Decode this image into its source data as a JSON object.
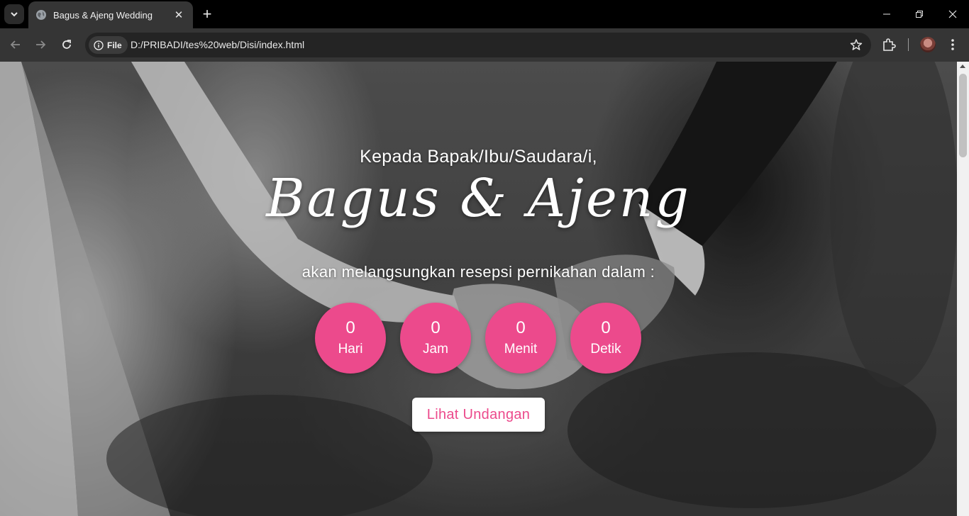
{
  "browser": {
    "tab_title": "Bagus & Ajeng Wedding",
    "url_chip": "File",
    "url": "D:/PRIBADI/tes%20web/Disi/index.html"
  },
  "page": {
    "greeting": "Kepada Bapak/Ibu/Saudara/i,",
    "couple": "Bagus & Ajeng",
    "subtitle": "akan melangsungkan resepsi pernikahan dalam :",
    "countdown": [
      {
        "value": "0",
        "label": "Hari"
      },
      {
        "value": "0",
        "label": "Jam"
      },
      {
        "value": "0",
        "label": "Menit"
      },
      {
        "value": "0",
        "label": "Detik"
      }
    ],
    "cta_label": "Lihat Undangan",
    "accent_color": "#ec4a8c"
  }
}
